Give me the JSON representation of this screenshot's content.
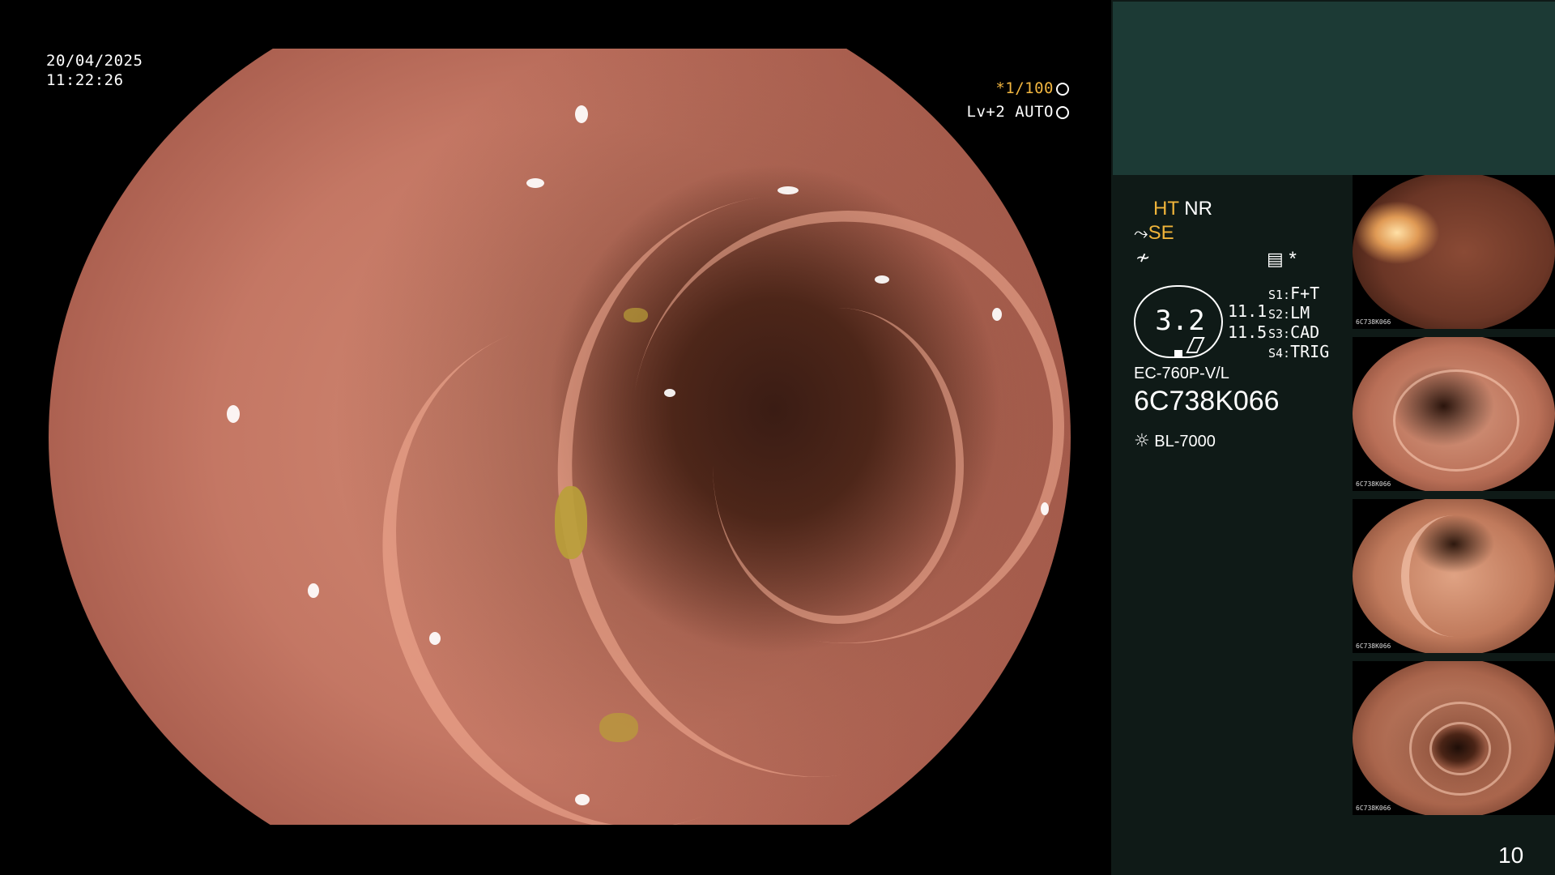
{
  "overlay": {
    "date": "20/04/2025",
    "time": "11:22:26",
    "shutter": "*1/100",
    "level": "Lv+2 AUTO"
  },
  "panel": {
    "ht": "HT",
    "nr": "NR",
    "se": "SE",
    "gauge_value": "3.2",
    "val1": "11.1",
    "val2": "11.5",
    "s1_label": "S1:",
    "s1_value": "F+T",
    "s2_label": "S2:",
    "s2_value": "LM",
    "s3_label": "S3:",
    "s3_value": "CAD",
    "s4_label": "S4:",
    "s4_value": "TRIG",
    "model": "EC-760P-V/L",
    "serial": "6C738K066",
    "light_source": "BL-7000",
    "asterisk": "*"
  },
  "thumbnails": [
    {
      "caption": "6C738K066"
    },
    {
      "caption": "6C738K066"
    },
    {
      "caption": "6C738K066"
    },
    {
      "caption": "6C738K066"
    }
  ],
  "page_number": "10",
  "icons": {
    "shutter": "aperture-icon",
    "level": "iris-icon",
    "scope": "scope-icon",
    "freeze": "freeze-icon",
    "memo": "memo-icon",
    "light": "light-source-icon"
  }
}
